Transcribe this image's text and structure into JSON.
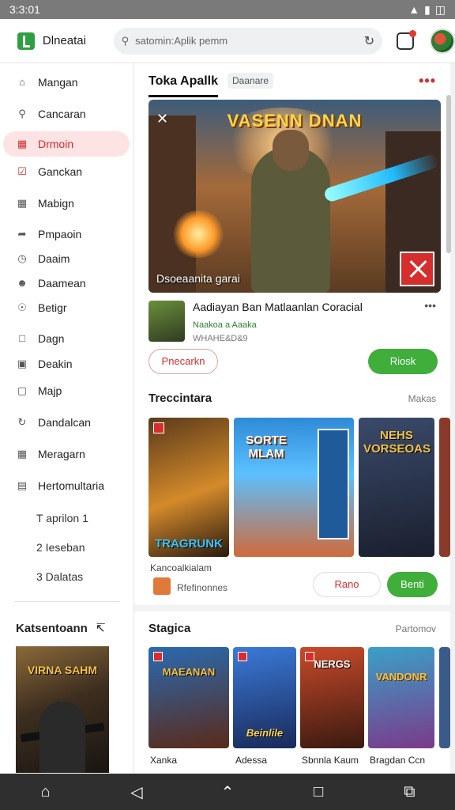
{
  "status": {
    "time": "3:3:01",
    "icons": [
      "wifi-icon",
      "signal-icon",
      "battery-icon"
    ]
  },
  "topbar": {
    "app_name": "Dlneatai",
    "search_placeholder": "satomin:Aplik pemm",
    "notification_count": "1"
  },
  "sidebar": {
    "items": [
      {
        "label": "Mangan",
        "icon": "home-icon"
      },
      {
        "label": "Cancaran",
        "icon": "search-icon"
      },
      {
        "label": "Drmoin",
        "icon": "gamepad-icon",
        "active": true
      },
      {
        "label": "Ganckan",
        "icon": "check-square-icon"
      },
      {
        "label": "Mabign",
        "icon": "grid-icon"
      },
      {
        "label": "Pmpaoin",
        "icon": "share-icon"
      },
      {
        "label": "Daaim",
        "icon": "clock-icon"
      },
      {
        "label": "Daamean",
        "icon": "user-icon"
      },
      {
        "label": "Betigr",
        "icon": "shield-icon"
      },
      {
        "label": "Dagn",
        "icon": "square-icon"
      },
      {
        "label": "Deakin",
        "icon": "lock-icon"
      },
      {
        "label": "Majp",
        "icon": "box-icon"
      },
      {
        "label": "Dandalcan",
        "icon": "refresh-icon"
      },
      {
        "label": "Meragarn",
        "icon": "grid-icon"
      },
      {
        "label": "Hertomultaria",
        "icon": "document-icon"
      }
    ],
    "subitems": [
      "T aprilon 1",
      "2 Ieseban",
      "3 Dalatas"
    ],
    "recent_title": "Katsentoann",
    "recent_cover_title": "VIRNA SAHM"
  },
  "main": {
    "tab_active": "Toka Apallk",
    "tab_chip": "Daanare",
    "hero": {
      "title": "VASENN DNAN",
      "caption": "Dsoeaanita garai"
    },
    "featured": {
      "name": "Aadiayan Ban Matlaanlan Coracial",
      "developer": "Naakoa a Aaaka",
      "meta": "WHAHE&D&9",
      "btn_secondary": "Pnecarkn",
      "btn_primary": "Riosk"
    },
    "section1": {
      "title": "Treccintara",
      "link": "Makas",
      "cards": [
        {
          "title": "TRAGRUNK"
        },
        {
          "title": "SORTE MLAM"
        },
        {
          "title": "NEHS VORSEOAS"
        }
      ],
      "row_title": "Kancoalkialam",
      "row_subtitle": "Rfefinonnes",
      "btn_secondary": "Rano",
      "btn_primary": "Benti"
    },
    "section2": {
      "title": "Stagica",
      "link": "Partomov",
      "cards": [
        {
          "title": "MAEANAN",
          "label": "Xanka"
        },
        {
          "title": "Beinlile",
          "label": "Adessa"
        },
        {
          "title": "NERGS",
          "label": "Sbnnla Kaum"
        },
        {
          "title": "VANDONR",
          "label": "Bragdan Ccn"
        }
      ]
    }
  },
  "colors": {
    "accent_red": "#d32f2f",
    "accent_green": "#3fae3b",
    "active_bg": "#fde3e3"
  }
}
